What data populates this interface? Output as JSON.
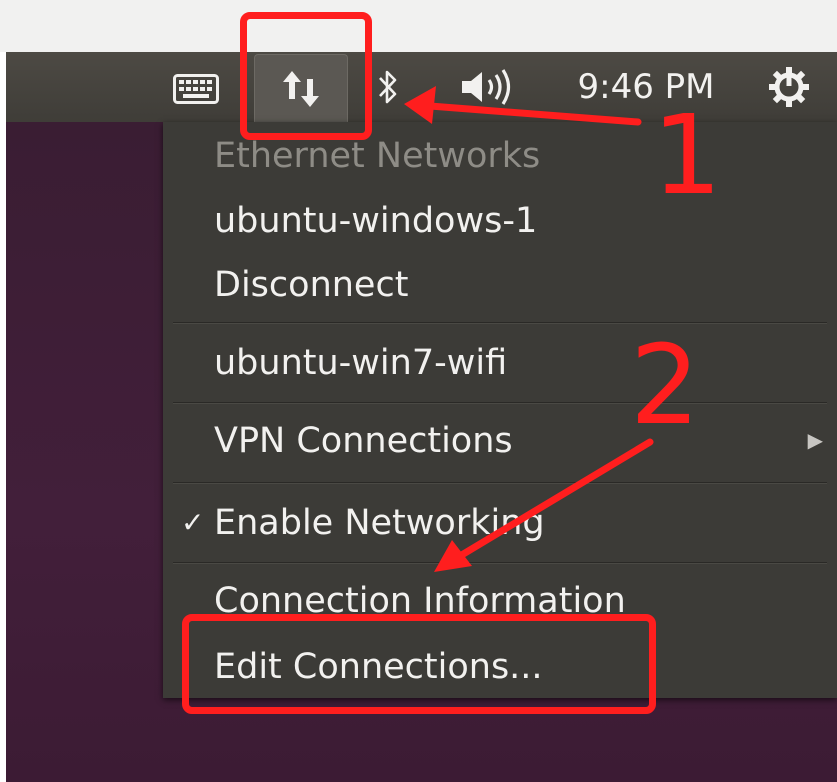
{
  "panel": {
    "clock": "9:46 PM",
    "indicators": [
      {
        "icon": "keyboard-icon"
      },
      {
        "icon": "network-updown-icon",
        "active": true
      },
      {
        "icon": "bluetooth-icon"
      },
      {
        "icon": "volume-icon"
      },
      {
        "icon": "power-gear-icon"
      }
    ]
  },
  "menu": {
    "section_header": "Ethernet Networks",
    "ethernet_connection": "ubuntu-windows-1",
    "disconnect": "Disconnect",
    "wifi_network": "ubuntu-win7-wifi",
    "vpn": "VPN Connections",
    "vpn_arrow": "▶",
    "enable_networking": "Enable Networking",
    "enable_networking_check": "✓",
    "connection_info": "Connection Information",
    "edit_connections": "Edit Connections..."
  },
  "annotations": {
    "step1": "1",
    "step2": "2",
    "color": "#ff1e1e"
  }
}
